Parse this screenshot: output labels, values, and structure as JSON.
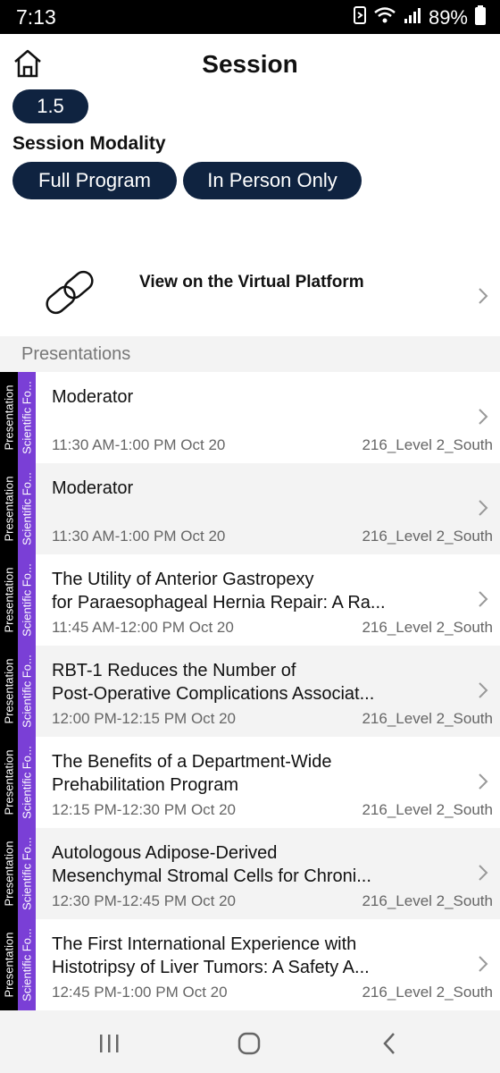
{
  "status_bar": {
    "time": "7:13",
    "battery": "89%"
  },
  "header": {
    "title": "Session"
  },
  "session": {
    "credit_value": "1.5",
    "modality_label": "Session Modality",
    "modality_options": [
      "Full Program",
      "In Person Only"
    ],
    "virtual_link_label": "View on the Virtual Platform"
  },
  "presentations": {
    "section_label": "Presentations",
    "items": [
      {
        "type_tag": "Presentation",
        "category_tag": "Scientific Fo...",
        "title_lines": [
          "Moderator"
        ],
        "time": "11:30 AM-1:00 PM",
        "date": "Oct 20",
        "location": "216_Level 2_South"
      },
      {
        "type_tag": "Presentation",
        "category_tag": "Scientific Fo...",
        "title_lines": [
          "Moderator"
        ],
        "time": "11:30 AM-1:00 PM",
        "date": "Oct 20",
        "location": "216_Level 2_South"
      },
      {
        "type_tag": "Presentation",
        "category_tag": "Scientific Fo...",
        "title_lines": [
          "The Utility of Anterior Gastropexy",
          "for Paraesophageal Hernia Repair: A Ra..."
        ],
        "time": "11:45 AM-12:00 PM",
        "date": "Oct 20",
        "location": "216_Level 2_South"
      },
      {
        "type_tag": "Presentation",
        "category_tag": "Scientific Fo...",
        "title_lines": [
          "RBT-1 Reduces the Number of",
          "Post-Operative Complications Associat..."
        ],
        "time": "12:00 PM-12:15 PM",
        "date": "Oct 20",
        "location": "216_Level 2_South"
      },
      {
        "type_tag": "Presentation",
        "category_tag": "Scientific Fo...",
        "title_lines": [
          "The Benefits of a Department-Wide",
          "Prehabilitation Program"
        ],
        "time": "12:15 PM-12:30 PM",
        "date": "Oct 20",
        "location": "216_Level 2_South"
      },
      {
        "type_tag": "Presentation",
        "category_tag": "Scientific Fo...",
        "title_lines": [
          "Autologous Adipose-Derived",
          "Mesenchymal Stromal Cells for Chroni..."
        ],
        "time": "12:30 PM-12:45 PM",
        "date": "Oct 20",
        "location": "216_Level 2_South"
      },
      {
        "type_tag": "Presentation",
        "category_tag": "Scientific Fo...",
        "title_lines": [
          "The First International Experience with",
          "Histotripsy of Liver Tumors: A Safety A..."
        ],
        "time": "12:45 PM-1:00 PM",
        "date": "Oct 20",
        "location": "216_Level 2_South"
      }
    ]
  },
  "icons": {
    "home": "home-icon",
    "link": "link-icon",
    "chevron": "chevron-right-icon",
    "nav_recents": "recents-icon",
    "nav_home": "nav-home-icon",
    "nav_back": "back-icon"
  },
  "colors": {
    "pill_bg": "#0f2340",
    "type_tag_bg": "#000000",
    "category_tag_bg": "#7a3fd6"
  }
}
